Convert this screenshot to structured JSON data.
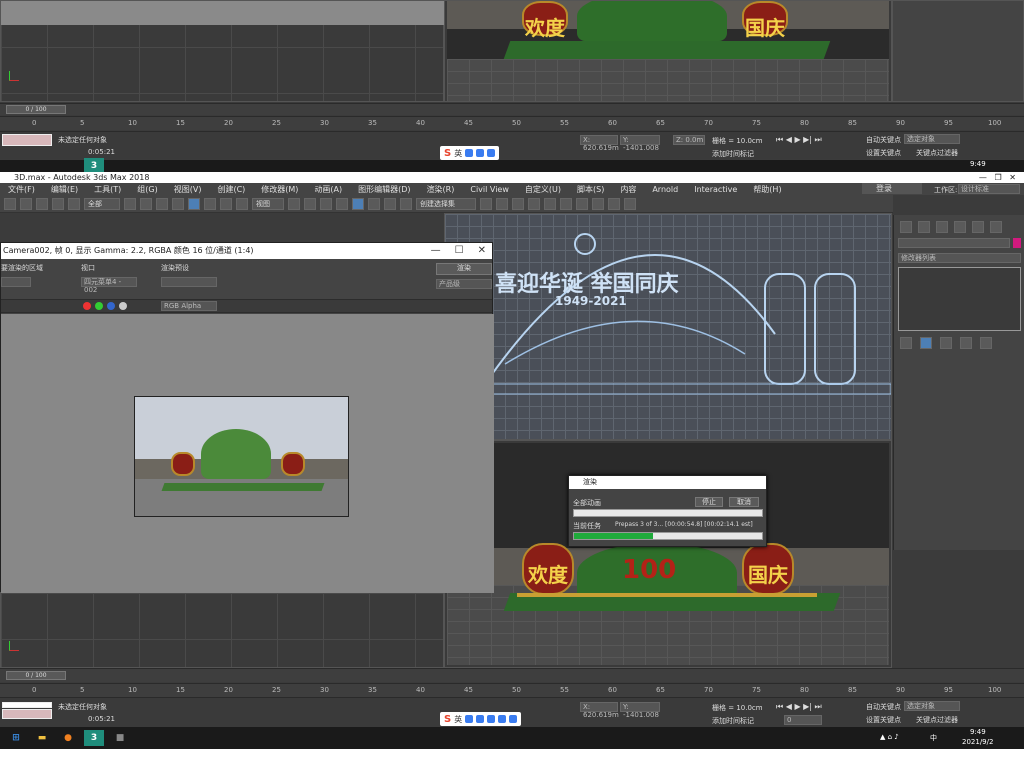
{
  "window": {
    "title": "3D.max - Autodesk 3ds Max 2018",
    "login": "登录",
    "workspace_label": "工作区:",
    "workspace_value": "设计标准"
  },
  "menu": [
    "文件(F)",
    "编辑(E)",
    "工具(T)",
    "组(G)",
    "视图(V)",
    "创建(C)",
    "修改器(M)",
    "动画(A)",
    "图形编辑器(D)",
    "渲染(R)",
    "Civil View",
    "自定义(U)",
    "脚本(S)",
    "内容",
    "Arnold",
    "Interactive",
    "帮助(H)"
  ],
  "toolbar": {
    "filter": "全部",
    "view": "视图",
    "selection_set": "创建选择集"
  },
  "timeline": {
    "frame_counter": "0 / 100",
    "ticks": [
      "0",
      "5",
      "10",
      "15",
      "20",
      "25",
      "30",
      "35",
      "40",
      "45",
      "50",
      "55",
      "60",
      "65",
      "70",
      "75",
      "80",
      "85",
      "90",
      "95",
      "100"
    ]
  },
  "status": {
    "message": "未选定任何对象",
    "time": "0:05:21",
    "x_field": "X: 620.619m",
    "y_field": "Y: -1401.008",
    "z_field": "Z: 0.0m",
    "grid": "栅格 = 10.0cm",
    "add_time_tag": "添加时间标记",
    "auto_key": "自动关键点",
    "selected_object": "选定对象",
    "set_key": "设置关键点",
    "key_filters": "关键点过滤器",
    "frame_field": "0"
  },
  "render_window": {
    "title": "Camera002, 帧 0, 显示 Gamma: 2.2, RGBA 颜色 16 位/通道 (1:4)",
    "area_label": "要渲染的区域",
    "viewport_label": "视口",
    "viewport_value": "四元菜单4 - 002",
    "preset_label": "渲染预设",
    "render_button": "渲染",
    "product_label": "产品级",
    "channel": "RGB Alpha"
  },
  "dialog": {
    "title": "渲染",
    "total_label": "全部动画",
    "stop_button": "停止",
    "cancel_button": "取消",
    "current_task_label": "当前任务",
    "current_task_value": "Prepass 3 of 3... [00:00:54.8] [00:02:14.1 est]",
    "progress": 0.42
  },
  "panel": {
    "modifier_list": "修改器列表"
  },
  "scene": {
    "left_lantern": "欢度",
    "right_lantern": "国庆",
    "center_text": "喜迎华诞 举国同庆",
    "years": "1949-2021"
  },
  "taskbar": {
    "time": "9:49",
    "date": "2021/9/2",
    "ime_lang": "中",
    "ime_char": "英"
  },
  "colors": {
    "accent": "#1faa3b",
    "red": "#b32217",
    "gold": "#f4d24a"
  }
}
